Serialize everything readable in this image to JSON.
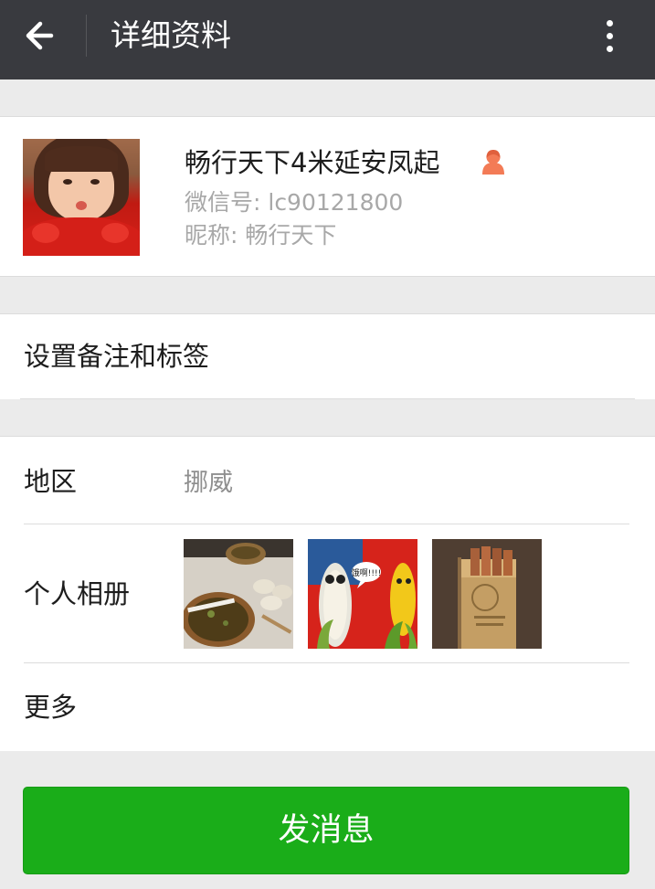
{
  "header": {
    "title": "详细资料",
    "back_icon": "arrow-left-icon",
    "more_icon": "more-vertical-icon"
  },
  "profile": {
    "name": "畅行天下4米延安凤起",
    "wechat_id": "微信号: lc90121800",
    "nickname": "昵称: 畅行天下",
    "gender_icon": "female-icon",
    "gender_color": "#f37b56"
  },
  "remark": {
    "label": "设置备注和标签"
  },
  "info": {
    "region_label": "地区",
    "region_value": "挪威",
    "album_label": "个人相册",
    "album_bubble_text": "饿啊!!!!",
    "more_label": "更多"
  },
  "actions": {
    "send_label": "发消息",
    "send_color": "#1aad19"
  },
  "theme": {
    "topbar_color": "#393a3f",
    "background": "#ebebeb"
  }
}
